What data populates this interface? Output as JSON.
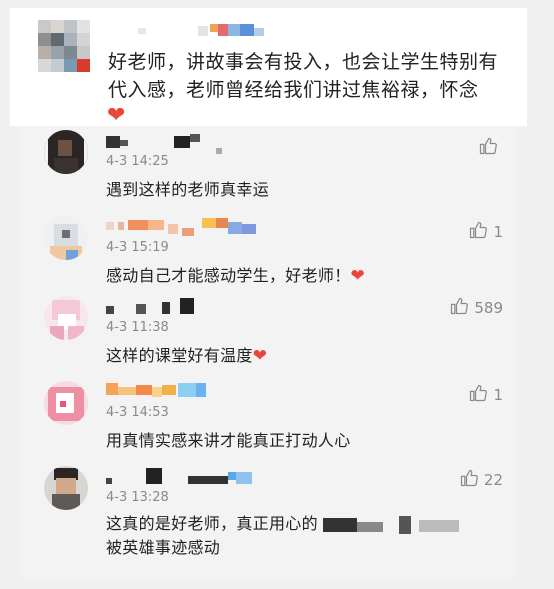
{
  "top_comment": {
    "text_line1": "好老师，讲故事会有投入，也会让学生特别有",
    "text_line2": "代入感，老师曾经给我们讲过焦裕禄，怀念",
    "emoji": "❤"
  },
  "comments": [
    {
      "date": "4-3 14:25",
      "text": "遇到这样的老师真幸运",
      "likes": ""
    },
    {
      "date": "4-3 15:19",
      "text": "感动自己才能感动学生，好老师！",
      "emoji": "❤",
      "likes": "1"
    },
    {
      "date": "4-3 11:38",
      "text": "这样的课堂好有温度",
      "emoji": "❤",
      "likes": "589"
    },
    {
      "date": "4-3 14:53",
      "text": "用真情实感来讲才能真正打动人心",
      "likes": "1"
    },
    {
      "date": "4-3 13:28",
      "text_line1": "这真的是好老师，真正用心的",
      "text_line2": "被英雄事迹感动",
      "likes": "22"
    }
  ],
  "colors": {
    "accent_heart": "#e8473c",
    "meta_gray": "#8a8a8a"
  },
  "icons": [
    "thumbs-up-icon",
    "heart-icon"
  ]
}
